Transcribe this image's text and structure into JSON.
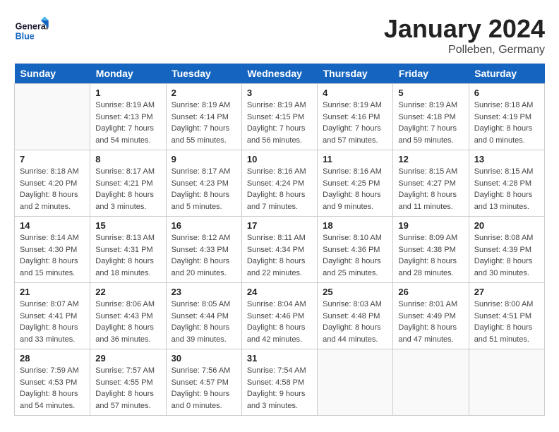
{
  "header": {
    "logo_line1": "General",
    "logo_line2": "Blue",
    "month": "January 2024",
    "location": "Polleben, Germany"
  },
  "days_of_week": [
    "Sunday",
    "Monday",
    "Tuesday",
    "Wednesday",
    "Thursday",
    "Friday",
    "Saturday"
  ],
  "weeks": [
    [
      {
        "day": "",
        "sunrise": "",
        "sunset": "",
        "daylight": "",
        "empty": true
      },
      {
        "day": "1",
        "sunrise": "Sunrise: 8:19 AM",
        "sunset": "Sunset: 4:13 PM",
        "daylight": "Daylight: 7 hours and 54 minutes."
      },
      {
        "day": "2",
        "sunrise": "Sunrise: 8:19 AM",
        "sunset": "Sunset: 4:14 PM",
        "daylight": "Daylight: 7 hours and 55 minutes."
      },
      {
        "day": "3",
        "sunrise": "Sunrise: 8:19 AM",
        "sunset": "Sunset: 4:15 PM",
        "daylight": "Daylight: 7 hours and 56 minutes."
      },
      {
        "day": "4",
        "sunrise": "Sunrise: 8:19 AM",
        "sunset": "Sunset: 4:16 PM",
        "daylight": "Daylight: 7 hours and 57 minutes."
      },
      {
        "day": "5",
        "sunrise": "Sunrise: 8:19 AM",
        "sunset": "Sunset: 4:18 PM",
        "daylight": "Daylight: 7 hours and 59 minutes."
      },
      {
        "day": "6",
        "sunrise": "Sunrise: 8:18 AM",
        "sunset": "Sunset: 4:19 PM",
        "daylight": "Daylight: 8 hours and 0 minutes."
      }
    ],
    [
      {
        "day": "7",
        "sunrise": "Sunrise: 8:18 AM",
        "sunset": "Sunset: 4:20 PM",
        "daylight": "Daylight: 8 hours and 2 minutes."
      },
      {
        "day": "8",
        "sunrise": "Sunrise: 8:17 AM",
        "sunset": "Sunset: 4:21 PM",
        "daylight": "Daylight: 8 hours and 3 minutes."
      },
      {
        "day": "9",
        "sunrise": "Sunrise: 8:17 AM",
        "sunset": "Sunset: 4:23 PM",
        "daylight": "Daylight: 8 hours and 5 minutes."
      },
      {
        "day": "10",
        "sunrise": "Sunrise: 8:16 AM",
        "sunset": "Sunset: 4:24 PM",
        "daylight": "Daylight: 8 hours and 7 minutes."
      },
      {
        "day": "11",
        "sunrise": "Sunrise: 8:16 AM",
        "sunset": "Sunset: 4:25 PM",
        "daylight": "Daylight: 8 hours and 9 minutes."
      },
      {
        "day": "12",
        "sunrise": "Sunrise: 8:15 AM",
        "sunset": "Sunset: 4:27 PM",
        "daylight": "Daylight: 8 hours and 11 minutes."
      },
      {
        "day": "13",
        "sunrise": "Sunrise: 8:15 AM",
        "sunset": "Sunset: 4:28 PM",
        "daylight": "Daylight: 8 hours and 13 minutes."
      }
    ],
    [
      {
        "day": "14",
        "sunrise": "Sunrise: 8:14 AM",
        "sunset": "Sunset: 4:30 PM",
        "daylight": "Daylight: 8 hours and 15 minutes."
      },
      {
        "day": "15",
        "sunrise": "Sunrise: 8:13 AM",
        "sunset": "Sunset: 4:31 PM",
        "daylight": "Daylight: 8 hours and 18 minutes."
      },
      {
        "day": "16",
        "sunrise": "Sunrise: 8:12 AM",
        "sunset": "Sunset: 4:33 PM",
        "daylight": "Daylight: 8 hours and 20 minutes."
      },
      {
        "day": "17",
        "sunrise": "Sunrise: 8:11 AM",
        "sunset": "Sunset: 4:34 PM",
        "daylight": "Daylight: 8 hours and 22 minutes."
      },
      {
        "day": "18",
        "sunrise": "Sunrise: 8:10 AM",
        "sunset": "Sunset: 4:36 PM",
        "daylight": "Daylight: 8 hours and 25 minutes."
      },
      {
        "day": "19",
        "sunrise": "Sunrise: 8:09 AM",
        "sunset": "Sunset: 4:38 PM",
        "daylight": "Daylight: 8 hours and 28 minutes."
      },
      {
        "day": "20",
        "sunrise": "Sunrise: 8:08 AM",
        "sunset": "Sunset: 4:39 PM",
        "daylight": "Daylight: 8 hours and 30 minutes."
      }
    ],
    [
      {
        "day": "21",
        "sunrise": "Sunrise: 8:07 AM",
        "sunset": "Sunset: 4:41 PM",
        "daylight": "Daylight: 8 hours and 33 minutes."
      },
      {
        "day": "22",
        "sunrise": "Sunrise: 8:06 AM",
        "sunset": "Sunset: 4:43 PM",
        "daylight": "Daylight: 8 hours and 36 minutes."
      },
      {
        "day": "23",
        "sunrise": "Sunrise: 8:05 AM",
        "sunset": "Sunset: 4:44 PM",
        "daylight": "Daylight: 8 hours and 39 minutes."
      },
      {
        "day": "24",
        "sunrise": "Sunrise: 8:04 AM",
        "sunset": "Sunset: 4:46 PM",
        "daylight": "Daylight: 8 hours and 42 minutes."
      },
      {
        "day": "25",
        "sunrise": "Sunrise: 8:03 AM",
        "sunset": "Sunset: 4:48 PM",
        "daylight": "Daylight: 8 hours and 44 minutes."
      },
      {
        "day": "26",
        "sunrise": "Sunrise: 8:01 AM",
        "sunset": "Sunset: 4:49 PM",
        "daylight": "Daylight: 8 hours and 47 minutes."
      },
      {
        "day": "27",
        "sunrise": "Sunrise: 8:00 AM",
        "sunset": "Sunset: 4:51 PM",
        "daylight": "Daylight: 8 hours and 51 minutes."
      }
    ],
    [
      {
        "day": "28",
        "sunrise": "Sunrise: 7:59 AM",
        "sunset": "Sunset: 4:53 PM",
        "daylight": "Daylight: 8 hours and 54 minutes."
      },
      {
        "day": "29",
        "sunrise": "Sunrise: 7:57 AM",
        "sunset": "Sunset: 4:55 PM",
        "daylight": "Daylight: 8 hours and 57 minutes."
      },
      {
        "day": "30",
        "sunrise": "Sunrise: 7:56 AM",
        "sunset": "Sunset: 4:57 PM",
        "daylight": "Daylight: 9 hours and 0 minutes."
      },
      {
        "day": "31",
        "sunrise": "Sunrise: 7:54 AM",
        "sunset": "Sunset: 4:58 PM",
        "daylight": "Daylight: 9 hours and 3 minutes."
      },
      {
        "day": "",
        "sunrise": "",
        "sunset": "",
        "daylight": "",
        "empty": true
      },
      {
        "day": "",
        "sunrise": "",
        "sunset": "",
        "daylight": "",
        "empty": true
      },
      {
        "day": "",
        "sunrise": "",
        "sunset": "",
        "daylight": "",
        "empty": true
      }
    ]
  ]
}
